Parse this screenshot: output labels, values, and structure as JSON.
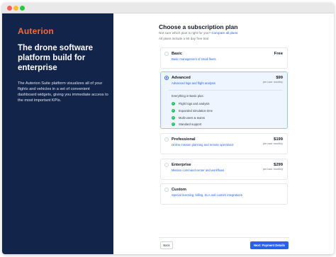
{
  "brand": {
    "logo_text": "Auterion",
    "logo_color": "#f26b3a",
    "sidebar_bg": "#13244a",
    "accent": "#2563eb"
  },
  "sidebar": {
    "headline": "The drone software platform build for enterprise",
    "blurb": "The Auterion Suite platform visualizes all of your flights and vehicles in a set of convenient dashboard widgets, giving you immediate access to the most important KPIs."
  },
  "main": {
    "title": "Choose a subscription plan",
    "subtitle": "Not sure which plan is right for you?",
    "compare_link": "Compare all plans",
    "trial_note": "All plans include a 90 day free trial"
  },
  "plans": [
    {
      "name": "Basic",
      "description": "Basic management of small fleets",
      "price": "Free",
      "per": ""
    },
    {
      "name": "Advanced",
      "description": "Advanced logs and flight analysis",
      "price": "$99",
      "per": "per user monthly",
      "selected": true,
      "features_heading": "Everything in Basic plus:",
      "features": [
        "Flight logs and analysis",
        "Expanded simulation time",
        "Multi-users & teams",
        "Standard support"
      ]
    },
    {
      "name": "Professional",
      "description": "Online mission planning and remote operations",
      "price": "$199",
      "per": "per user monthly"
    },
    {
      "name": "Enterprise",
      "description": "Mission command center and workflows",
      "price": "$299",
      "per": "per user monthly"
    },
    {
      "name": "Custom",
      "description": "Special licensing, billing, SLA and custom integrations",
      "price": "",
      "per": ""
    }
  ],
  "footer": {
    "back_label": "Back",
    "next_label": "Next: Payment Details"
  }
}
